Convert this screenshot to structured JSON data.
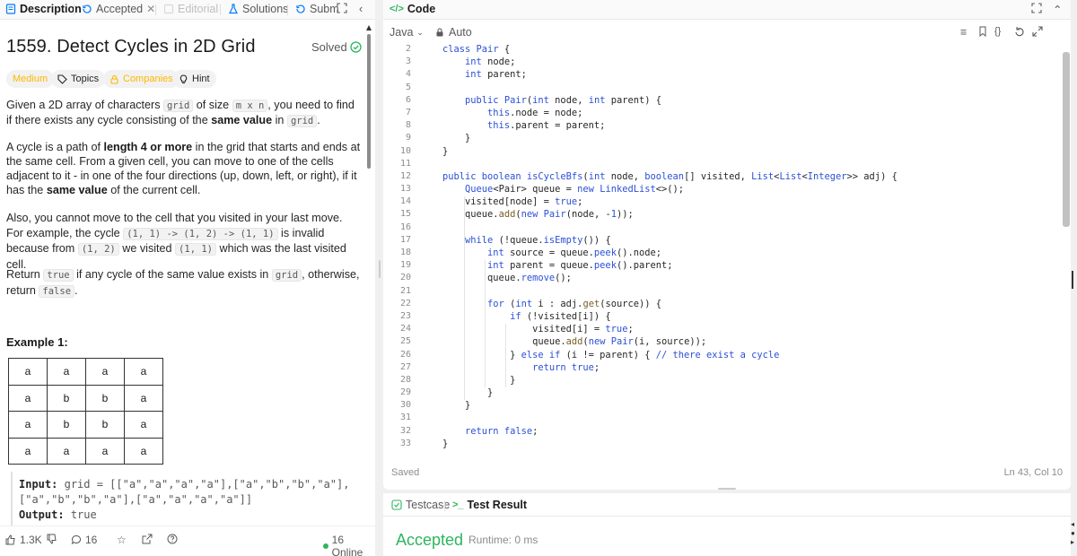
{
  "left_tabs": {
    "description": "Description",
    "accepted": "Accepted",
    "editorial": "Editorial",
    "solutions": "Solutions",
    "submissions": "Subm"
  },
  "problem": {
    "title": "1559. Detect Cycles in 2D Grid",
    "solved": "Solved",
    "difficulty": "Medium",
    "topics": "Topics",
    "companies": "Companies",
    "hint": "Hint"
  },
  "description": {
    "p1_a": "Given a 2D array of characters ",
    "p1_code1": "grid",
    "p1_b": " of size ",
    "p1_code2": "m x n",
    "p1_c": ", you need to find if there exists any cycle consisting of the ",
    "p1_bold": "same value",
    "p1_d": " in ",
    "p1_code3": "grid",
    "p1_e": ".",
    "p2_a": "A cycle is a path of ",
    "p2_bold1": "length 4 or more",
    "p2_b": " in the grid that starts and ends at the same cell. From a given cell, you can move to one of the cells adjacent to it - in one of the four directions (up, down, left, or right), if it has the ",
    "p2_bold2": "same value",
    "p2_c": " of the current cell.",
    "p3_a": "Also, you cannot move to the cell that you visited in your last move. For example, the cycle ",
    "p3_code1": "(1, 1) -> (1, 2) -> (1, 1)",
    "p3_b": " is invalid because from ",
    "p3_code2": "(1, 2)",
    "p3_c": " we visited ",
    "p3_code3": "(1, 1)",
    "p3_d": " which was the last visited cell.",
    "p4_a": "Return ",
    "p4_code1": "true",
    "p4_b": " if any cycle of the same value exists in ",
    "p4_code2": "grid",
    "p4_c": ", otherwise, return ",
    "p4_code3": "false",
    "p4_d": "."
  },
  "example": {
    "heading": "Example 1:",
    "grid": [
      [
        "a",
        "a",
        "a",
        "a"
      ],
      [
        "a",
        "b",
        "b",
        "a"
      ],
      [
        "a",
        "b",
        "b",
        "a"
      ],
      [
        "a",
        "a",
        "a",
        "a"
      ]
    ],
    "input_label": "Input:",
    "input_value": "grid = [[\"a\",\"a\",\"a\",\"a\"],[\"a\",\"b\",\"b\",\"a\"],[\"a\",\"b\",\"b\",\"a\"],[\"a\",\"a\",\"a\",\"a\"]]",
    "output_label": "Output:",
    "output_value": "true"
  },
  "footer_left": {
    "likes": "1.3K",
    "comments": "16",
    "online": "16 Online"
  },
  "editor": {
    "tab_label": "Code",
    "language": "Java",
    "autosave": "Auto",
    "saved": "Saved",
    "cursor": "Ln 43, Col 10",
    "line_numbers": [
      "2",
      "3",
      "4",
      "5",
      "6",
      "7",
      "8",
      "9",
      "10",
      "11",
      "12",
      "13",
      "14",
      "15",
      "16",
      "17",
      "18",
      "19",
      "20",
      "21",
      "22",
      "23",
      "24",
      "25",
      "26",
      "27",
      "28",
      "29",
      "30",
      "31",
      "32",
      "33"
    ]
  },
  "bottom": {
    "testcase": "Testcase",
    "test_result": "Test Result",
    "status": "Accepted",
    "runtime": "Runtime: 0 ms"
  },
  "colors": {
    "accent_blue": "#2b50d6",
    "success_green": "#2db55d",
    "medium_orange": "#ffb800",
    "link_blue": "#007aff"
  }
}
